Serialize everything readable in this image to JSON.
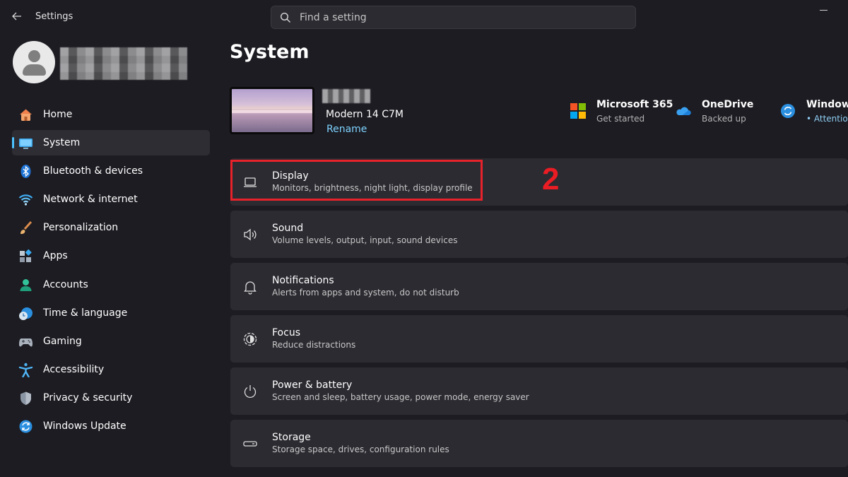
{
  "window": {
    "title": "Settings"
  },
  "search": {
    "placeholder": "Find a setting"
  },
  "sidebar": {
    "items": [
      {
        "label": "Home",
        "icon": "home-icon"
      },
      {
        "label": "System",
        "icon": "system-icon",
        "active": true
      },
      {
        "label": "Bluetooth & devices",
        "icon": "bluetooth-icon"
      },
      {
        "label": "Network & internet",
        "icon": "wifi-icon"
      },
      {
        "label": "Personalization",
        "icon": "brush-icon"
      },
      {
        "label": "Apps",
        "icon": "apps-icon"
      },
      {
        "label": "Accounts",
        "icon": "accounts-icon"
      },
      {
        "label": "Time & language",
        "icon": "clock-globe-icon"
      },
      {
        "label": "Gaming",
        "icon": "gamepad-icon"
      },
      {
        "label": "Accessibility",
        "icon": "accessibility-icon"
      },
      {
        "label": "Privacy & security",
        "icon": "shield-icon"
      },
      {
        "label": "Windows Update",
        "icon": "update-icon"
      }
    ]
  },
  "main": {
    "title": "System",
    "device": {
      "model": "Modern 14 C7M",
      "rename_label": "Rename"
    },
    "quick_links": [
      {
        "title": "Microsoft 365",
        "subtitle": "Get started",
        "icon": "microsoft-logo-icon"
      },
      {
        "title": "OneDrive",
        "subtitle": "Backed up",
        "icon": "onedrive-cloud-icon"
      },
      {
        "title": "Windows",
        "subtitle": "• Attentio",
        "icon": "windows-update-icon"
      }
    ],
    "cards": [
      {
        "title": "Display",
        "subtitle": "Monitors, brightness, night light, display profile",
        "icon": "laptop-icon"
      },
      {
        "title": "Sound",
        "subtitle": "Volume levels, output, input, sound devices",
        "icon": "speaker-icon"
      },
      {
        "title": "Notifications",
        "subtitle": "Alerts from apps and system, do not disturb",
        "icon": "bell-icon"
      },
      {
        "title": "Focus",
        "subtitle": "Reduce distractions",
        "icon": "focus-icon"
      },
      {
        "title": "Power & battery",
        "subtitle": "Screen and sleep, battery usage, power mode, energy saver",
        "icon": "power-icon"
      },
      {
        "title": "Storage",
        "subtitle": "Storage space, drives, configuration rules",
        "icon": "storage-icon"
      }
    ]
  },
  "annotation": {
    "step_number": "2",
    "color": "#e8222a"
  },
  "colors": {
    "accent": "#4cc2ff",
    "background": "#1c1c22",
    "card": "#2b2b31"
  }
}
